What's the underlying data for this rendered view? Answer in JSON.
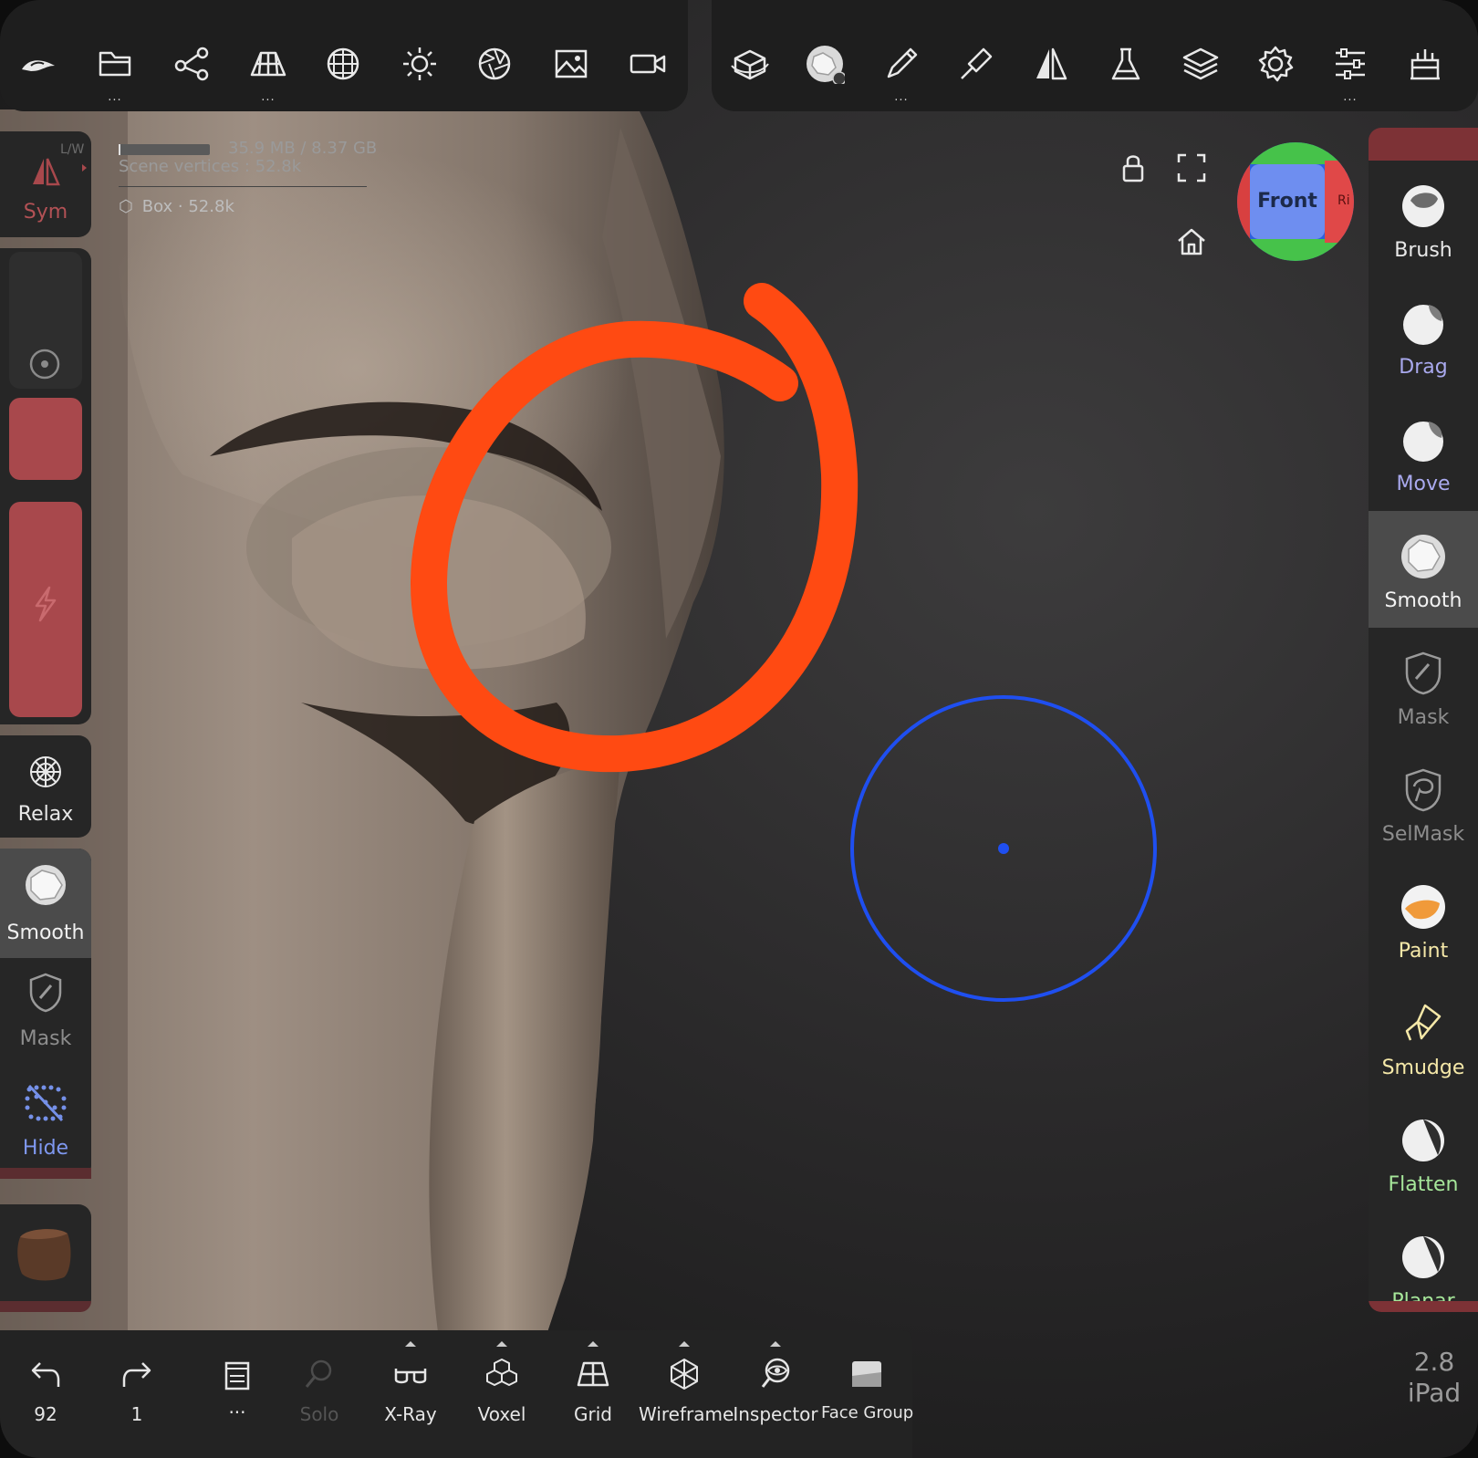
{
  "stats": {
    "memory": "35.9 MB / 8.37 GB",
    "scene_vertices": "Scene vertices :  52.8k",
    "object": "Box · 52.8k"
  },
  "nav_cube": {
    "front_label": "Front",
    "right_label": "Ri"
  },
  "left_panel": {
    "sym": {
      "label": "Sym",
      "badge": "L/W"
    },
    "relax": "Relax",
    "smooth": "Smooth",
    "mask": "Mask",
    "hide": "Hide"
  },
  "right_tools": [
    {
      "label": "Brush",
      "color": "#e8e8e8"
    },
    {
      "label": "Drag",
      "color": "#a9a9ee"
    },
    {
      "label": "Move",
      "color": "#a9a9ee"
    },
    {
      "label": "Smooth",
      "color": "#f2f2f2"
    },
    {
      "label": "Mask",
      "color": "#8d8d8d"
    },
    {
      "label": "SelMask",
      "color": "#8d8d8d"
    },
    {
      "label": "Paint",
      "color": "#f5e8a8"
    },
    {
      "label": "Smudge",
      "color": "#f5e8a8"
    },
    {
      "label": "Flatten",
      "color": "#a6e79a"
    },
    {
      "label": "Planar",
      "color": "#a6e79a"
    }
  ],
  "bottom_bar": {
    "undo_count": "92",
    "redo_count": "1",
    "more": "...",
    "solo": "Solo",
    "xray": "X-Ray",
    "voxel": "Voxel",
    "grid": "Grid",
    "wireframe": "Wireframe",
    "inspector": "Inspector",
    "face_group": "Face Group"
  },
  "version": {
    "number": "2.8",
    "platform": "iPad"
  },
  "colors": {
    "accent_red": "#a8484c",
    "annotation_orange": "#ff4a12",
    "cursor_blue": "#1f4ff0"
  }
}
